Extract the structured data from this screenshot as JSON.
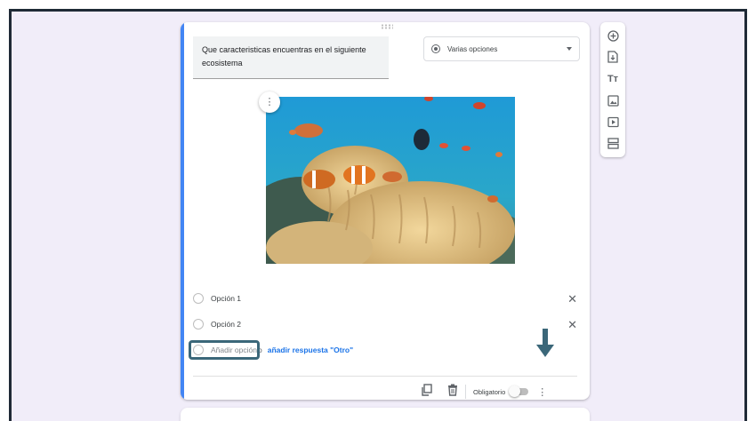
{
  "question": {
    "title": "Que caracteristicas encuentras en el siguiente ecosistema",
    "type_label": "Varias opciones"
  },
  "image": {
    "alt": "coral-reef-image",
    "more_icon": "more-vertical-icon"
  },
  "options": [
    {
      "label": "Opción 1",
      "icon": "radio-icon",
      "remove_icon": "close-icon"
    },
    {
      "label": "Opción 2",
      "icon": "radio-icon",
      "remove_icon": "close-icon"
    }
  ],
  "add_option": {
    "label": "Añadir opción",
    "or_text": "o",
    "add_other": "añadir respuesta \"Otro\""
  },
  "footer": {
    "required_label": "Obligatorio",
    "required_on": false
  },
  "toolbar": [
    {
      "name": "add-question",
      "icon": "plus-circle-icon"
    },
    {
      "name": "import-questions",
      "icon": "import-icon"
    },
    {
      "name": "add-title",
      "icon": "title-icon"
    },
    {
      "name": "add-image",
      "icon": "image-icon"
    },
    {
      "name": "add-video",
      "icon": "video-icon"
    },
    {
      "name": "add-section",
      "icon": "section-icon"
    }
  ],
  "colors": {
    "accent": "#4285f4",
    "link": "#1a73e8",
    "annotation": "#3b6779",
    "background": "#f1edf9"
  }
}
